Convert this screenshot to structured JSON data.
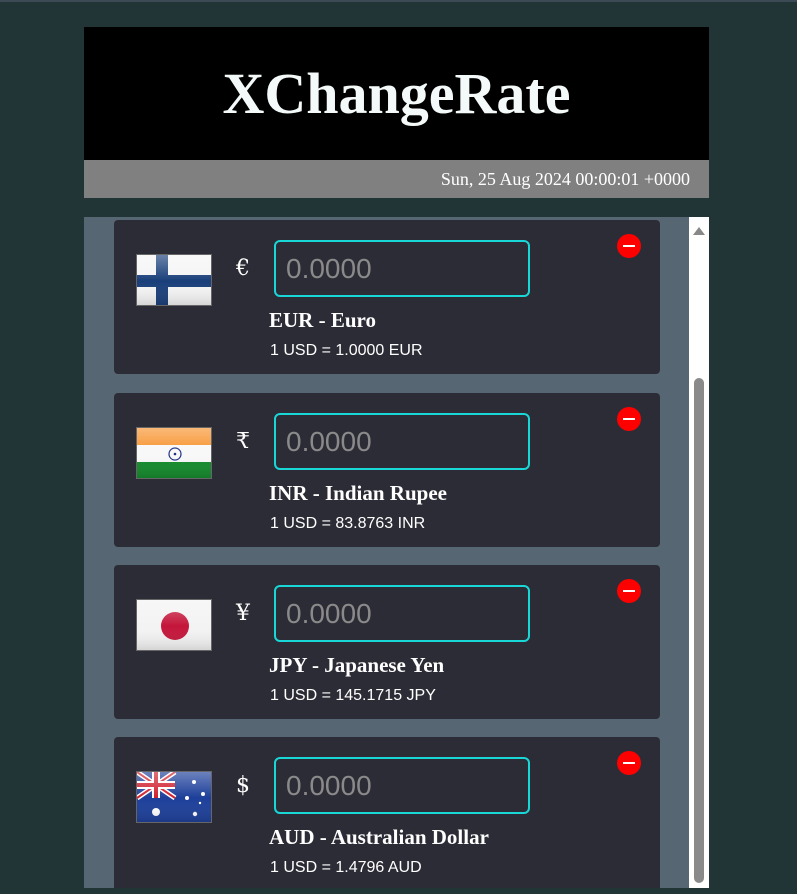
{
  "app": {
    "title": "XChangeRate",
    "date": "Sun, 25 Aug 2024 00:00:01 +0000"
  },
  "currencies": [
    {
      "code_name": "EUR - Euro",
      "symbol": "€",
      "placeholder": "0.0000",
      "rate_text": "1 USD = 1.0000 EUR",
      "flag": "finland-flag-icon"
    },
    {
      "code_name": "INR - Indian Rupee",
      "symbol": "₹",
      "placeholder": "0.0000",
      "rate_text": "1 USD = 83.8763 INR",
      "flag": "india-flag-icon"
    },
    {
      "code_name": "JPY - Japanese Yen",
      "symbol": "¥",
      "placeholder": "0.0000",
      "rate_text": "1 USD = 145.1715 JPY",
      "flag": "japan-flag-icon"
    },
    {
      "code_name": "AUD - Australian Dollar",
      "symbol": "$",
      "placeholder": "0.0000",
      "rate_text": "1 USD = 1.4796 AUD",
      "flag": "australia-flag-icon"
    }
  ],
  "colors": {
    "page_bg": "#213537",
    "header_bg": "#000000",
    "datebar_bg": "#808080",
    "list_bg": "#566672",
    "card_bg": "#2c2c36",
    "input_border": "#19d7d7",
    "remove_button": "#ff0000"
  }
}
